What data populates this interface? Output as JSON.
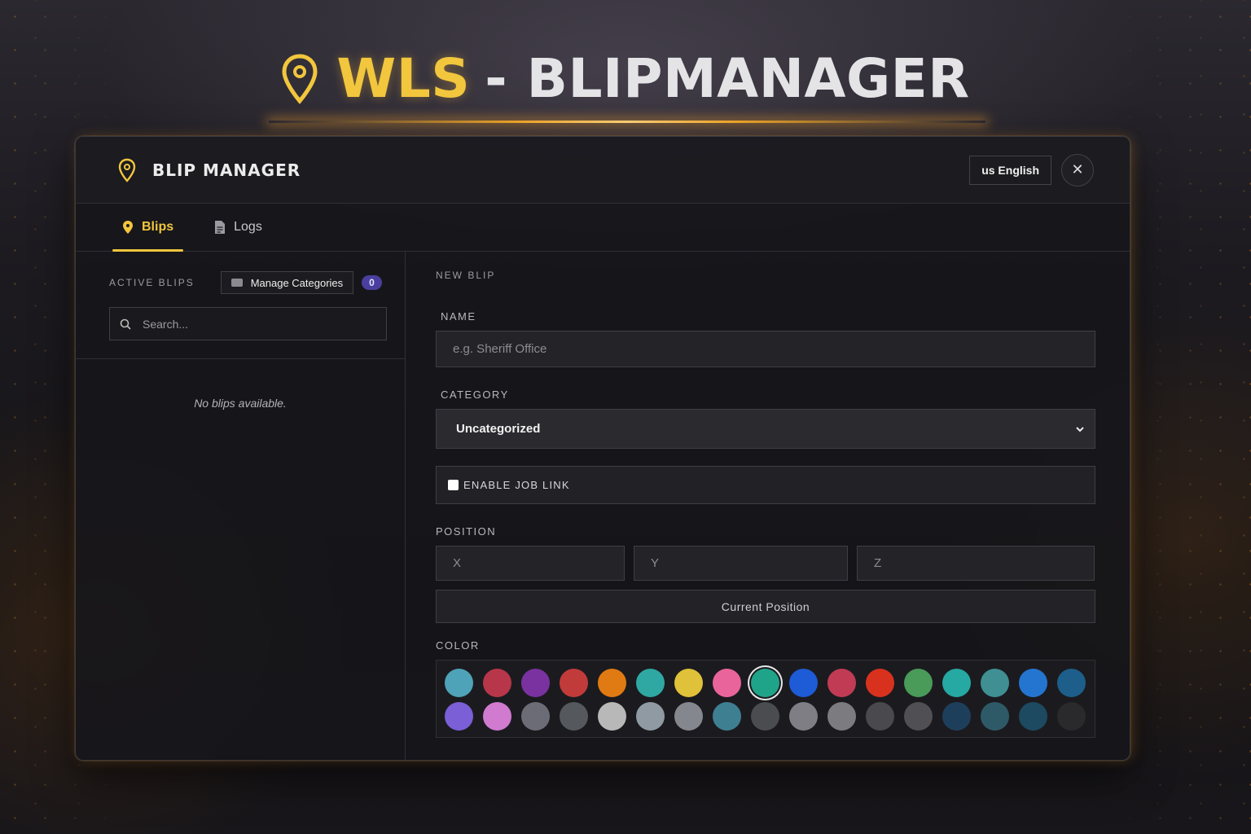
{
  "headline": {
    "part1": "WLS",
    "part2": "- BLIPMANAGER"
  },
  "window": {
    "title": "BLIP MANAGER",
    "language_button": "us English",
    "close_symbol": "✕"
  },
  "tabs": [
    {
      "label": "Blips",
      "active": true,
      "icon": "map-pin-icon"
    },
    {
      "label": "Logs",
      "active": false,
      "icon": "document-icon"
    }
  ],
  "left_panel": {
    "section_label": "ACTIVE BLIPS",
    "manage_button": "Manage Categories",
    "count_badge": "0",
    "search_placeholder": "Search...",
    "empty_text": "No blips available."
  },
  "form": {
    "section_label": "NEW BLIP",
    "name_label": "NAME",
    "name_placeholder": "e.g. Sheriff Office",
    "category_label": "CATEGORY",
    "category_value": "Uncategorized",
    "job_link_label": "ENABLE JOB LINK",
    "position_label": "POSITION",
    "x_placeholder": "X",
    "y_placeholder": "Y",
    "z_placeholder": "Z",
    "current_position_button": "Current Position",
    "color_label": "COLOR"
  },
  "colors": {
    "accent": "#f2c63d",
    "selected_index": 8,
    "swatches": [
      "#4fa3b8",
      "#b8364a",
      "#7a32a0",
      "#c23b3b",
      "#e07a12",
      "#2fa8a3",
      "#e0c13a",
      "#e9649a",
      "#1fa48a",
      "#1e5bd6",
      "#c23b54",
      "#d8321f",
      "#4a9a5a",
      "#26a8a3",
      "#3f8f93",
      "#2475d0",
      "#1d5e8a",
      "#7b5fd6",
      "#d07ad0",
      "#6c6c76",
      "#55585c",
      "#b8b8b8",
      "#8f9aa3",
      "#84888e",
      "#3f7f92",
      "#4a4c50",
      "#7e7e84",
      "#7c7c80",
      "#4a4a4e",
      "#505054",
      "#1e3f5c",
      "#2e5a68",
      "#1d4a60",
      "#2a2a2c"
    ]
  }
}
